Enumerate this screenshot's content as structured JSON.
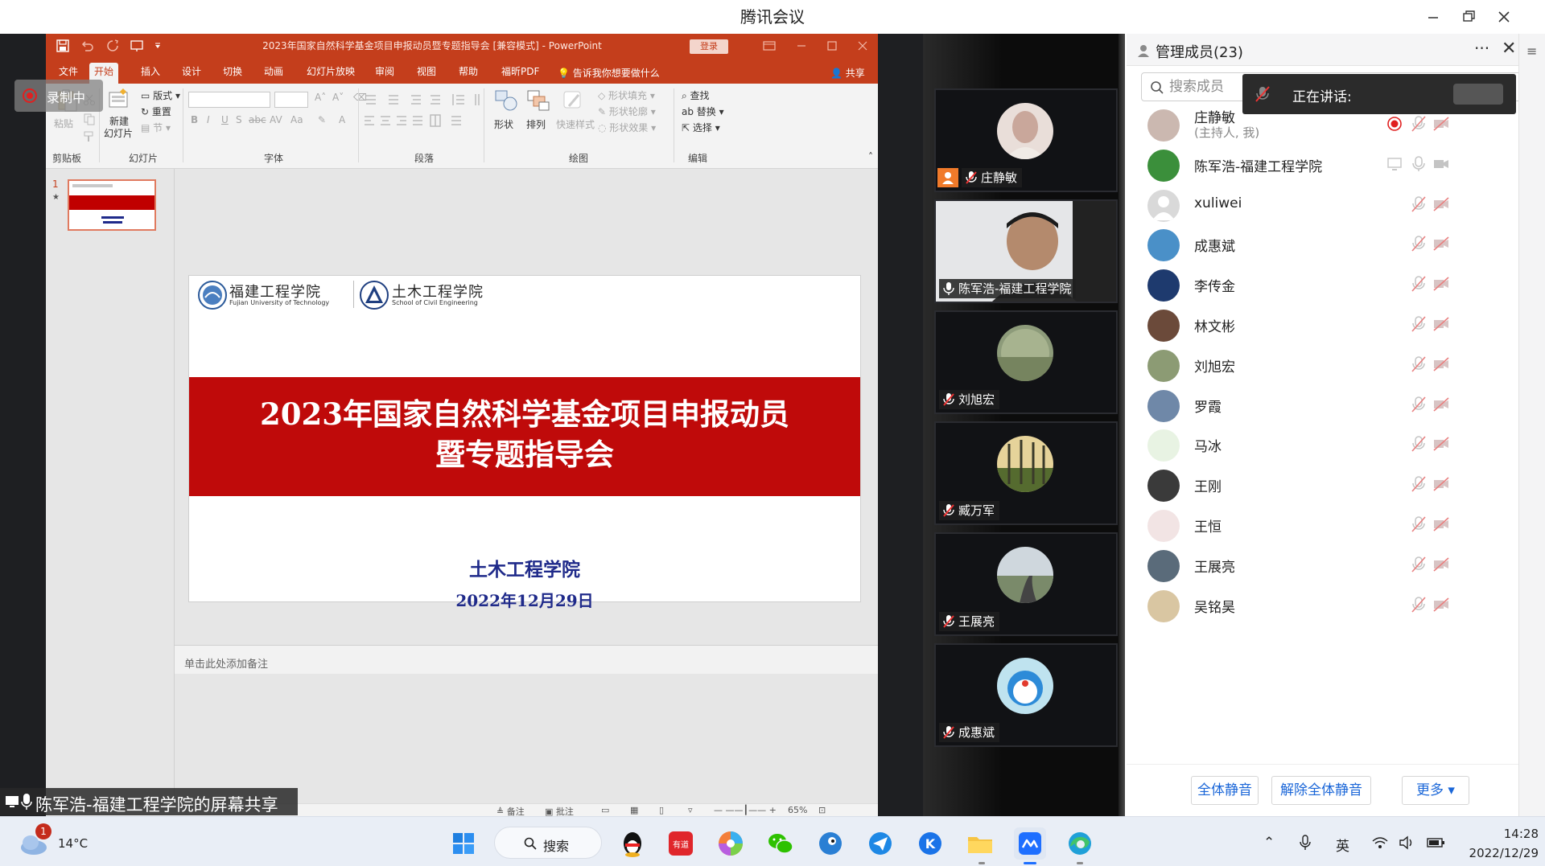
{
  "window": {
    "title": "腾讯会议"
  },
  "ppt": {
    "doc_title": "2023年国家自然科学基金项目申报动员暨专题指导会 [兼容模式] - PowerPoint",
    "login": "登录",
    "tabs": [
      "文件",
      "开始",
      "插入",
      "设计",
      "切换",
      "动画",
      "幻灯片放映",
      "审阅",
      "视图",
      "帮助",
      "福昕PDF"
    ],
    "active_tab": "开始",
    "tell_me": "告诉我你想要做什么",
    "share": "共享",
    "ribbon": {
      "paste": "粘贴",
      "clipboard": "剪贴板",
      "new_slide": "新建",
      "new_slide2": "幻灯片",
      "layout": "版式",
      "reset": "重置",
      "section": "节",
      "slides": "幻灯片",
      "font": "字体",
      "paragraph": "段落",
      "shape": "形状",
      "arrange": "排列",
      "quick_styles": "快速样式",
      "shape_fill": "形状填充",
      "shape_outline": "形状轮廓",
      "shape_effects": "形状效果",
      "drawing": "绘图",
      "find": "查找",
      "replace": "替换",
      "select": "选择",
      "editing": "编辑"
    },
    "slide_number": "1",
    "slide": {
      "univ_cn": "福建工程学院",
      "univ_en": "Fujian University of Technology",
      "school_cn": "土木工程学院",
      "school_en": "School of Civil Engineering",
      "title_line1": "2023年国家自然科学基金项目申报动员",
      "title_line2": "暨专题指导会",
      "school": "土木工程学院",
      "date": "2022年12月29日"
    },
    "notes_placeholder": "单击此处添加备注",
    "status": {
      "notes": "备注",
      "comments": "批注",
      "zoom": "65%"
    }
  },
  "recording": {
    "label": "录制中"
  },
  "share_label": "陈军浩-福建工程学院的屏幕共享",
  "video_tiles": [
    {
      "name": "庄静敏",
      "host": true,
      "video": false
    },
    {
      "name": "陈军浩-福建工程学院",
      "host": false,
      "video": true
    },
    {
      "name": "刘旭宏",
      "host": false,
      "video": false
    },
    {
      "name": "臧万军",
      "host": false,
      "video": false
    },
    {
      "name": "王展亮",
      "host": false,
      "video": false
    },
    {
      "name": "成惠斌",
      "host": false,
      "video": false
    }
  ],
  "panel": {
    "title": "管理成员(23)",
    "more": "···",
    "close": "✕",
    "search_placeholder": "搜索成员",
    "speaking": "正在讲话:",
    "members": [
      {
        "name": "庄静敏",
        "sub": "(主持人, 我)",
        "recording": true
      },
      {
        "name": "陈军浩-福建工程学院",
        "sub": "",
        "recording": false
      },
      {
        "name": "xuliwei",
        "sub": "",
        "recording": false
      },
      {
        "name": "成惠斌",
        "sub": "",
        "recording": false
      },
      {
        "name": "李传金",
        "sub": "",
        "recording": false
      },
      {
        "name": "林文彬",
        "sub": "",
        "recording": false
      },
      {
        "name": "刘旭宏",
        "sub": "",
        "recording": false
      },
      {
        "name": "罗霞",
        "sub": "",
        "recording": false
      },
      {
        "name": "马冰",
        "sub": "",
        "recording": false
      },
      {
        "name": "王刚",
        "sub": "",
        "recording": false
      },
      {
        "name": "王恒",
        "sub": "",
        "recording": false
      },
      {
        "name": "王展亮",
        "sub": "",
        "recording": false
      },
      {
        "name": "吴铭昊",
        "sub": "",
        "recording": false
      }
    ],
    "mute_all": "全体静音",
    "unmute_all": "解除全体静音",
    "more_btn": "更多 ▾"
  },
  "taskbar": {
    "temperature": "14°C",
    "weather_badge": "1",
    "search": "搜索",
    "ime": "英",
    "time": "14:28",
    "date": "2022/12/29"
  },
  "colors": {
    "ppt_accent": "#c43e1c",
    "slide_band": "#bf0a0a",
    "slide_text_blue": "#1f2a8a",
    "link_blue": "#1a66d8",
    "record_red": "#e02020"
  }
}
